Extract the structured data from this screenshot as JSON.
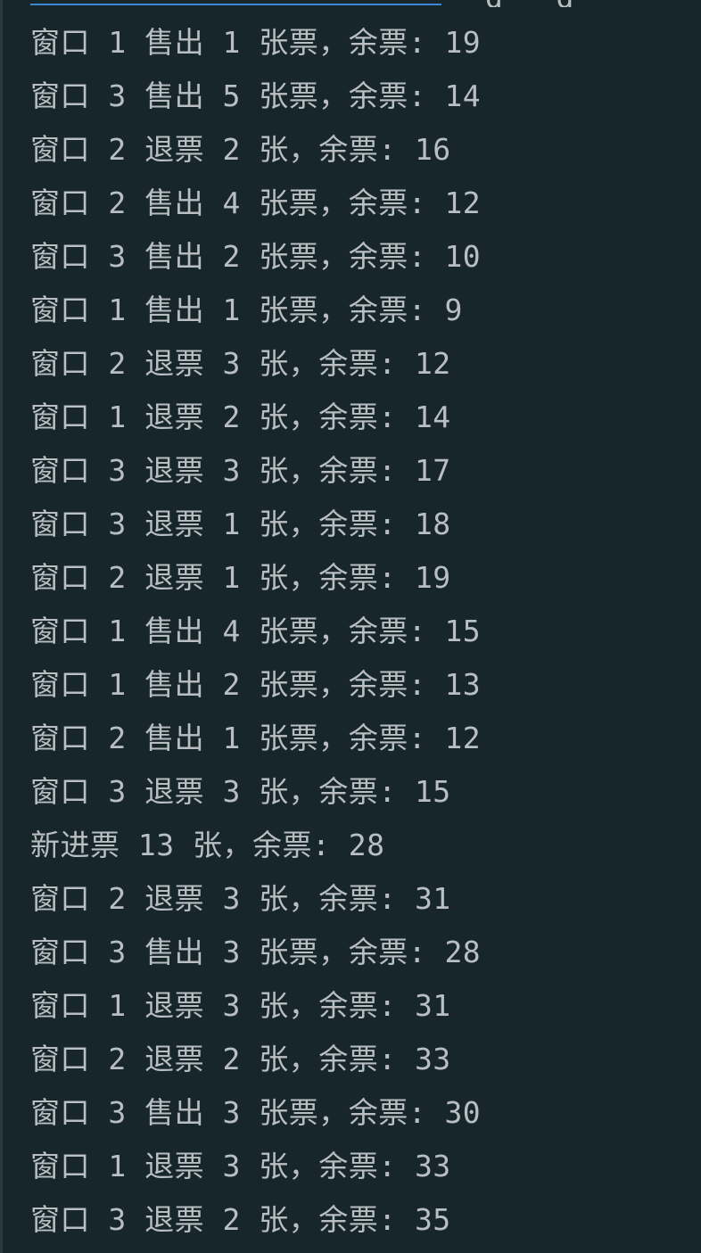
{
  "console": {
    "top_partial_text": "g   g",
    "lines": [
      "窗口 1 售出 1 张票，余票: 19",
      "窗口 3 售出 5 张票，余票: 14",
      "窗口 2 退票 2 张，余票: 16",
      "窗口 2 售出 4 张票，余票: 12",
      "窗口 3 售出 2 张票，余票: 10",
      "窗口 1 售出 1 张票，余票: 9",
      "窗口 2 退票 3 张，余票: 12",
      "窗口 1 退票 2 张，余票: 14",
      "窗口 3 退票 3 张，余票: 17",
      "窗口 3 退票 1 张，余票: 18",
      "窗口 2 退票 1 张，余票: 19",
      "窗口 1 售出 4 张票，余票: 15",
      "窗口 1 售出 2 张票，余票: 13",
      "窗口 2 售出 1 张票，余票: 12",
      "窗口 3 退票 3 张，余票: 15",
      "新进票 13 张，余票: 28",
      "窗口 2 退票 3 张，余票: 31",
      "窗口 3 售出 3 张票，余票: 28",
      "窗口 1 退票 3 张，余票: 31",
      "窗口 2 退票 2 张，余票: 33",
      "窗口 3 售出 3 张票，余票: 30",
      "窗口 1 退票 3 张，余票: 33",
      "窗口 3 退票 2 张，余票: 35"
    ]
  },
  "colors": {
    "background": "#16262a",
    "text": "#b8bec1",
    "link": "#3b87d6",
    "gutter": "#263a3e"
  }
}
